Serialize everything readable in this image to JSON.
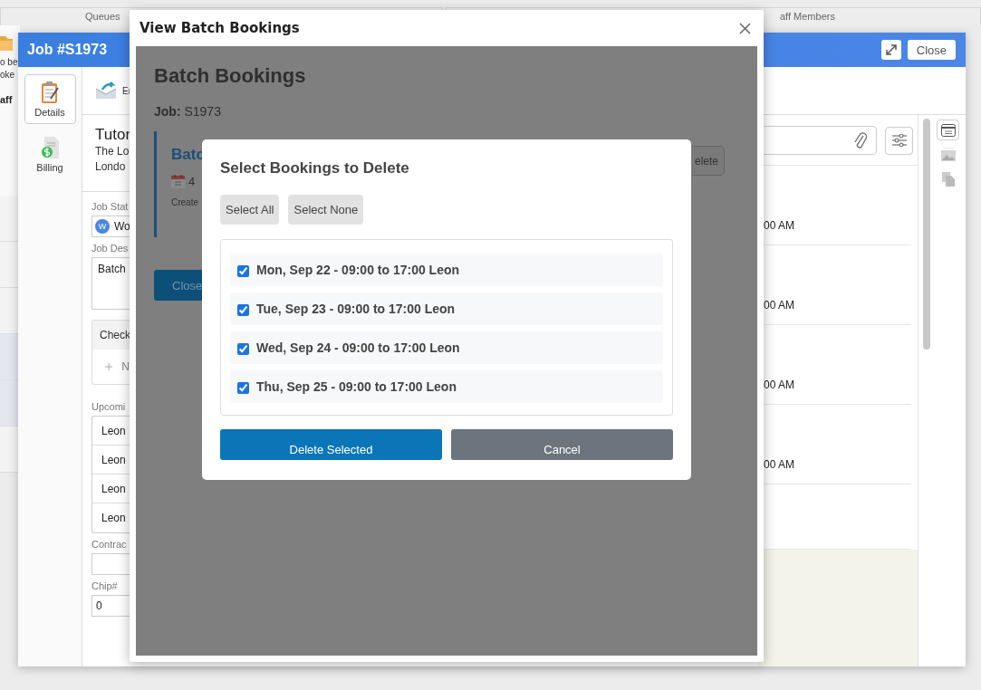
{
  "app": {
    "tabs": [
      {
        "label": "Queues"
      },
      {
        "label": "aff Members"
      }
    ],
    "side_note": [
      "o be",
      "oke"
    ],
    "side_heading": "aff"
  },
  "job_window": {
    "title": "Job #S1973",
    "close_button": "Close",
    "rail": [
      {
        "kind": "details",
        "label": "Details",
        "selected": true
      },
      {
        "kind": "billing",
        "label": "Billing",
        "selected": false
      }
    ],
    "toolbar_label": "Er",
    "heading": "Tutor",
    "address": [
      "The Lo",
      "Londo"
    ],
    "form": {
      "status": {
        "label": "Job Stat",
        "avatar": "W",
        "value": "Wo"
      },
      "description": {
        "label": "Job Des",
        "value": "Batch"
      },
      "checklist": {
        "title": "Check",
        "add_label": "N"
      },
      "upcoming": {
        "label": "Upcomi",
        "items": [
          "Leon",
          "Leon",
          "Leon",
          "Leon"
        ]
      },
      "contract": {
        "label": "Contrac"
      },
      "chip": {
        "label": "Chip#",
        "value": "0"
      }
    },
    "activity_times": [
      "00 AM",
      "00 AM",
      "00 AM",
      "00 AM"
    ]
  },
  "dialog": {
    "title": "View Batch Bookings",
    "heading": "Batch Bookings",
    "job": "**Job:** S1973",
    "card": {
      "title": "Batc",
      "count": "4",
      "created": "Create",
      "delete_button": "elete"
    },
    "close_button": "Close",
    "delete_modal": {
      "title": "Select Bookings to Delete",
      "select_all": "Select All",
      "select_none": "Select None",
      "bookings": [
        {
          "label": "Mon, Sep 22 - 09:00 to 17:00 Leon",
          "checked": true
        },
        {
          "label": "Tue, Sep 23 - 09:00 to 17:00 Leon",
          "checked": true
        },
        {
          "label": "Wed, Sep 24 - 09:00 to 17:00 Leon",
          "checked": true
        },
        {
          "label": "Thu, Sep 25 - 09:00 to 17:00 Leon",
          "checked": true
        }
      ],
      "delete_button": "Delete Selected",
      "cancel_button": "Cancel"
    }
  }
}
